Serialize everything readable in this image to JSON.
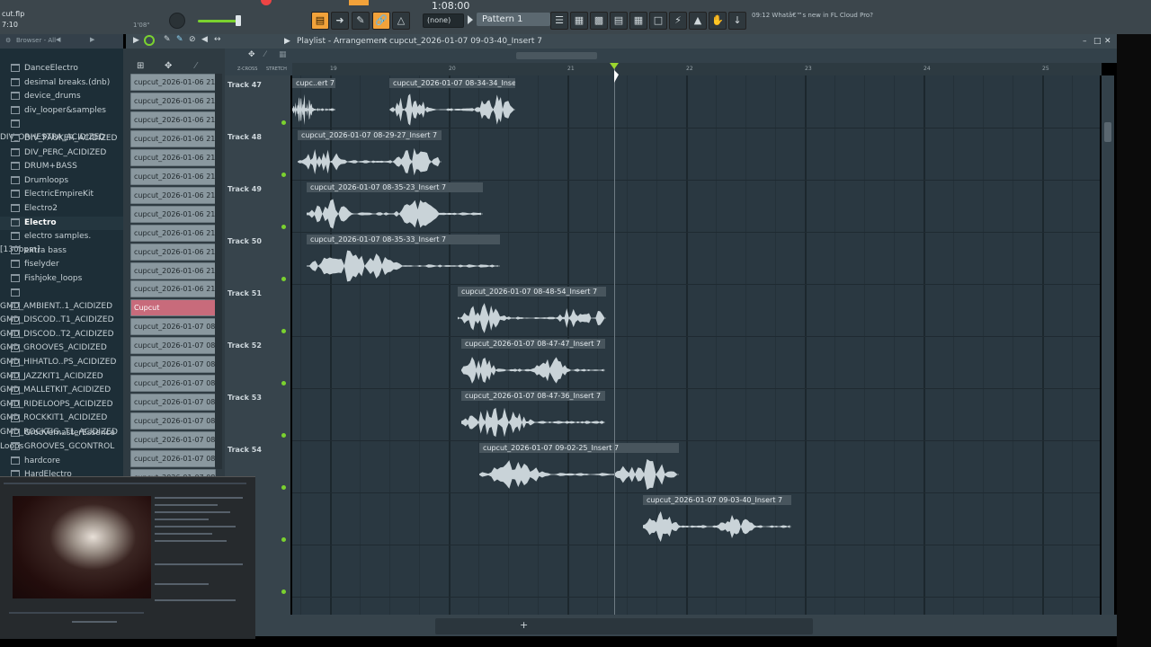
{
  "toolbar": {
    "file_name": "cut.flp",
    "time_short": "7:10",
    "song_time": "1:08:00",
    "time_sub": "1'08\"",
    "pattern_mode": "(none)",
    "pattern_label": "Pattern 1",
    "news_time": "09:12",
    "news_text": "Whatâ€™s new in FL Cloud Pro?"
  },
  "browser": {
    "header": "Browser - All",
    "items": [
      {
        "label": "DanceElectro"
      },
      {
        "label": "desimal breaks.(dnb)"
      },
      {
        "label": "device_drums"
      },
      {
        "label": "div_looper&samples"
      },
      {
        "label": "DIV_ORHESTRA_ACIDIZED"
      },
      {
        "label": "DIV_PAUKER_ACIDIZED"
      },
      {
        "label": "DIV_PERC_ACIDIZED"
      },
      {
        "label": "DRUM+BASS"
      },
      {
        "label": "Drumloops"
      },
      {
        "label": "ElectricEmpireKit"
      },
      {
        "label": "Electro2"
      },
      {
        "label": "Electro",
        "selected": true
      },
      {
        "label": "electro samples.[130bpm]"
      },
      {
        "label": "extra bass"
      },
      {
        "label": "fiselyder"
      },
      {
        "label": "Fishjoke_loops"
      },
      {
        "label": "GMD_AMBIENT..1_ACIDIZED"
      },
      {
        "label": "GMD_DISCOD..T1_ACIDIZED"
      },
      {
        "label": "GMD_DISCOD..T2_ACIDIZED"
      },
      {
        "label": "GMD_GROOVES_ACIDIZED"
      },
      {
        "label": "GMD_HIHATLO..PS_ACIDIZED"
      },
      {
        "label": "GMD_JAZZKIT1_ACIDIZED"
      },
      {
        "label": "GMD_MALLETKIT_ACIDIZED"
      },
      {
        "label": "GMD_RIDELOOPS_ACIDIZED"
      },
      {
        "label": "GMD_ROCKKIT1_ACIDIZED"
      },
      {
        "label": "GMD_ROCKTIG..T1_ACIDIZED"
      },
      {
        "label": "GroovemasterEssence Loops"
      },
      {
        "label": "GROOVES_GCONTROL"
      },
      {
        "label": "hardcore"
      },
      {
        "label": "HardElectro"
      }
    ]
  },
  "picker": {
    "items": [
      {
        "label": "cupcut_2026-01-06 21-1.."
      },
      {
        "label": "cupcut_2026-01-06 21-1.."
      },
      {
        "label": "cupcut_2026-01-06 21-1.."
      },
      {
        "label": "cupcut_2026-01-06 21-1.."
      },
      {
        "label": "cupcut_2026-01-06 21-1.."
      },
      {
        "label": "cupcut_2026-01-06 21-1.."
      },
      {
        "label": "cupcut_2026-01-06 21-1.."
      },
      {
        "label": "cupcut_2026-01-06 21-1.."
      },
      {
        "label": "cupcut_2026-01-06 21-2.."
      },
      {
        "label": "cupcut_2026-01-06 21-2.."
      },
      {
        "label": "cupcut_2026-01-06 21-2.."
      },
      {
        "label": "cupcut_2026-01-06 21-2.."
      },
      {
        "label": "Cupcut",
        "active": true
      },
      {
        "label": "cupcut_2026-01-07 08-2.."
      },
      {
        "label": "cupcut_2026-01-07 08-2.."
      },
      {
        "label": "cupcut_2026-01-07 08-2.."
      },
      {
        "label": "cupcut_2026-01-07 08-2.."
      },
      {
        "label": "cupcut_2026-01-07 08-2.."
      },
      {
        "label": "cupcut_2026-01-07 08-3.."
      },
      {
        "label": "cupcut_2026-01-07 08-3.."
      },
      {
        "label": "cupcut_2026-01-07 08-3.."
      },
      {
        "label": "cupcut_2026-01-07 08-3.."
      }
    ]
  },
  "playlist": {
    "title": "Playlist - Arrangement",
    "breadcrumb": "cupcut_2026-01-07 09-03-40_Insert 7",
    "snap_label": "Z-CROSS",
    "stretch_label": "STRETCH",
    "bars": [
      "19",
      "20",
      "21",
      "22",
      "23",
      "24",
      "25"
    ],
    "tracks": [
      {
        "name": "Track 47",
        "clips": [
          {
            "label": "cupc..ert 7"
          },
          {
            "label": "cupcut_2026-01-07 08-34-34_Insert 7"
          }
        ]
      },
      {
        "name": "Track 48",
        "clips": [
          {
            "label": "cupcut_2026-01-07 08-29-27_Insert 7"
          }
        ]
      },
      {
        "name": "Track 49",
        "clips": [
          {
            "label": "cupcut_2026-01-07 08-35-23_Insert 7"
          }
        ]
      },
      {
        "name": "Track 50",
        "clips": [
          {
            "label": "cupcut_2026-01-07 08-35-33_Insert 7"
          }
        ]
      },
      {
        "name": "Track 51",
        "clips": [
          {
            "label": "cupcut_2026-01-07 08-48-54_Insert 7"
          }
        ]
      },
      {
        "name": "Track 52",
        "clips": [
          {
            "label": "cupcut_2026-01-07 08-47-47_Insert 7"
          }
        ]
      },
      {
        "name": "Track 53",
        "clips": [
          {
            "label": "cupcut_2026-01-07 08-47-36_Insert 7"
          }
        ]
      },
      {
        "name": "Track 54",
        "clips": [
          {
            "label": "cupcut_2026-01-07 09-02-25_Insert 7"
          }
        ]
      },
      {
        "name": "",
        "clips": [
          {
            "label": "cupcut_2026-01-07 09-03-40_Insert 7"
          }
        ]
      },
      {
        "name": "",
        "clips": []
      }
    ],
    "add_label": "+"
  },
  "colors": {
    "accent_orange": "#f2a23a",
    "accent_green": "#7bd22f",
    "clip_bg": "#48555d",
    "picker_active": "#c86b7b"
  }
}
